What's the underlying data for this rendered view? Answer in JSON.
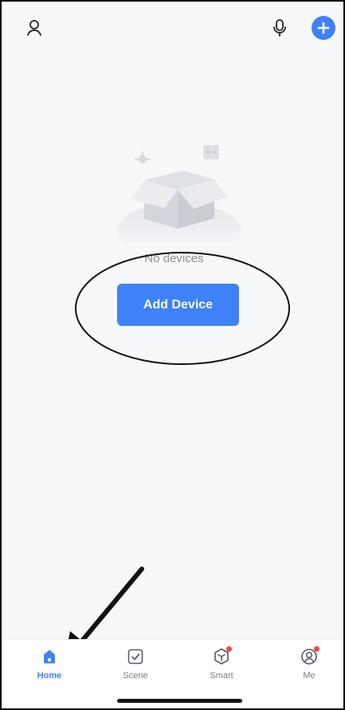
{
  "header": {
    "profile_icon": "user-icon",
    "voice_icon": "mic-icon",
    "add_icon": "plus-icon"
  },
  "empty_state": {
    "message": "No devices",
    "cta_label": "Add Device"
  },
  "tabs": [
    {
      "label": "Home",
      "icon": "home-icon",
      "active": true
    },
    {
      "label": "Scene",
      "icon": "scene-check-icon",
      "active": false
    },
    {
      "label": "Smart",
      "icon": "smart-icon",
      "badge": true
    },
    {
      "label": "Me",
      "icon": "profile-circle-icon",
      "badge": true
    }
  ],
  "colors": {
    "accent": "#3f82f7",
    "background": "#f7f8fa",
    "text_muted": "#8e9096",
    "badge": "#ef4b4b"
  }
}
